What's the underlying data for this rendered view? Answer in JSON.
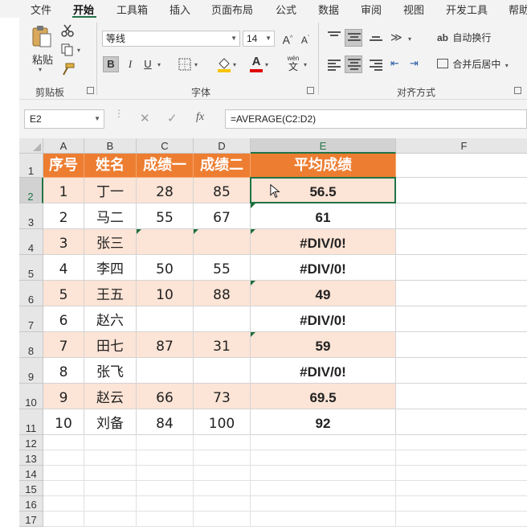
{
  "menu": {
    "tabs": [
      "文件",
      "开始",
      "工具箱",
      "插入",
      "页面布局",
      "公式",
      "数据",
      "审阅",
      "视图",
      "开发工具",
      "帮助"
    ],
    "active": "开始"
  },
  "ribbon": {
    "clipboard": {
      "paste": "粘贴",
      "label": "剪贴板"
    },
    "font": {
      "name": "等线",
      "size": "14",
      "label": "字体",
      "bold": "B",
      "italic": "I",
      "underline": "U",
      "grow": "A",
      "shrink": "A",
      "font_color": "A",
      "phonetic": "wén"
    },
    "alignment": {
      "wrap": "自动换行",
      "merge": "合并后居中",
      "label": "对齐方式"
    }
  },
  "formula_bar": {
    "name_box": "E2",
    "formula": "=AVERAGE(C2:D2)",
    "fx": "fx"
  },
  "columns": [
    "A",
    "B",
    "C",
    "D",
    "E",
    "F"
  ],
  "selected_column": "E",
  "row_numbers": [
    "1",
    "2",
    "3",
    "4",
    "5",
    "6",
    "7",
    "8",
    "9",
    "10",
    "11",
    "12",
    "13",
    "14",
    "15",
    "16",
    "17"
  ],
  "selected_row": "2",
  "headers": [
    "序号",
    "姓名",
    "成绩一",
    "成绩二",
    "平均成绩"
  ],
  "rows": [
    [
      "1",
      "丁一",
      "28",
      "85",
      "56.5"
    ],
    [
      "2",
      "马二",
      "55",
      "67",
      "61"
    ],
    [
      "3",
      "张三",
      "",
      "",
      "#DIV/0!"
    ],
    [
      "4",
      "李四",
      "50",
      "55",
      "#DIV/0!"
    ],
    [
      "5",
      "王五",
      "10",
      "88",
      "49"
    ],
    [
      "6",
      "赵六",
      "",
      "",
      "#DIV/0!"
    ],
    [
      "7",
      "田七",
      "87",
      "31",
      "59"
    ],
    [
      "8",
      "张飞",
      "",
      "",
      "#DIV/0!"
    ],
    [
      "9",
      "赵云",
      "66",
      "73",
      "69.5"
    ],
    [
      "10",
      "刘备",
      "84",
      "100",
      "92"
    ]
  ],
  "colors": {
    "header_fill": "#ed7d31",
    "band_fill": "#fce4d6",
    "accent": "#217346"
  }
}
